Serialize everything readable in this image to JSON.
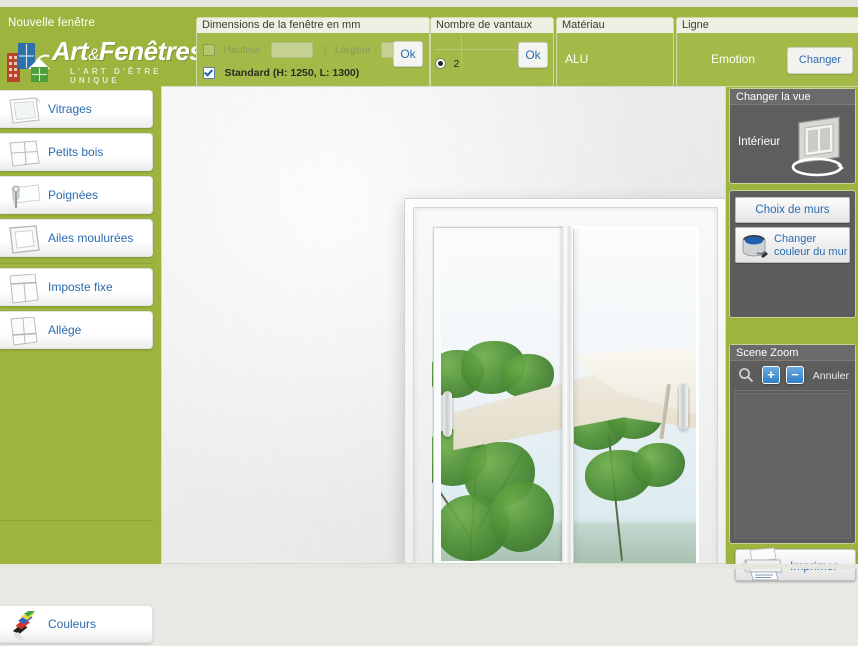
{
  "header": {
    "title": "Nouvelle fenêtre",
    "logo_text": "Art",
    "logo_amp": "&",
    "logo_text2": "Fenêtres",
    "logo_sub": "L'ART D'ÊTRE UNIQUE",
    "logo_icon": "building-window-logo-icon"
  },
  "toolbar": {
    "dimensions": {
      "title": "Dimensions de la fenêtre en mm",
      "custom_checked": false,
      "hauteur_label": "Hauteur :",
      "hauteur_value": "",
      "separator": "|",
      "largeur_label": "Largeur :",
      "largeur_value": "",
      "standard_checked": true,
      "standard_label": "Standard (H: 1250, L: 1300)",
      "ok_label": "Ok"
    },
    "vantaux": {
      "title": "Nombre de vantaux",
      "selected": "2",
      "ok_label": "Ok"
    },
    "materiau": {
      "title": "Matériau",
      "value": "ALU"
    },
    "ligne": {
      "title": "Ligne",
      "value": "Emotion",
      "change_label": "Changer"
    }
  },
  "left_sidebar": {
    "items": [
      {
        "label": "Vitrages",
        "icon": "window-pane-icon"
      },
      {
        "label": "Petits bois",
        "icon": "window-grid-icon"
      },
      {
        "label": "Poignées",
        "icon": "window-handle-icon"
      },
      {
        "label": "Ailes moulurées",
        "icon": "window-moulding-icon"
      },
      {
        "label": "Imposte fixe",
        "icon": "window-transom-icon"
      },
      {
        "label": "Allège",
        "icon": "window-sill-icon"
      }
    ],
    "bottom_item": {
      "label": "Couleurs",
      "icon": "color-palette-icon"
    }
  },
  "right_sidebar": {
    "view_panel": {
      "title": "Changer la vue",
      "value": "Intérieur",
      "icon": "window-rotate-icon"
    },
    "walls_panel": {
      "choice_label": "Choix de murs",
      "color_label": "Changer couleur du mur",
      "color_icon": "paint-bucket-icon"
    },
    "zoom_panel": {
      "title": "Scene Zoom",
      "magnifier_icon": "magnifier-icon",
      "zoom_in_label": "+",
      "zoom_out_label": "−",
      "cancel_label": "Annuler"
    },
    "print_button": {
      "label": "Imprimer",
      "icon": "printer-icon"
    }
  },
  "canvas": {
    "product": "sliding-window-2-panes",
    "scene": "outdoor-garden-with-parasol-and-trees"
  },
  "colors": {
    "brand_green": "#9db43f",
    "panel_green": "#a3ba48",
    "link_blue": "#2a6bb0",
    "panel_dark": "#5d5d5d",
    "title_bar": "#eef0e3"
  }
}
